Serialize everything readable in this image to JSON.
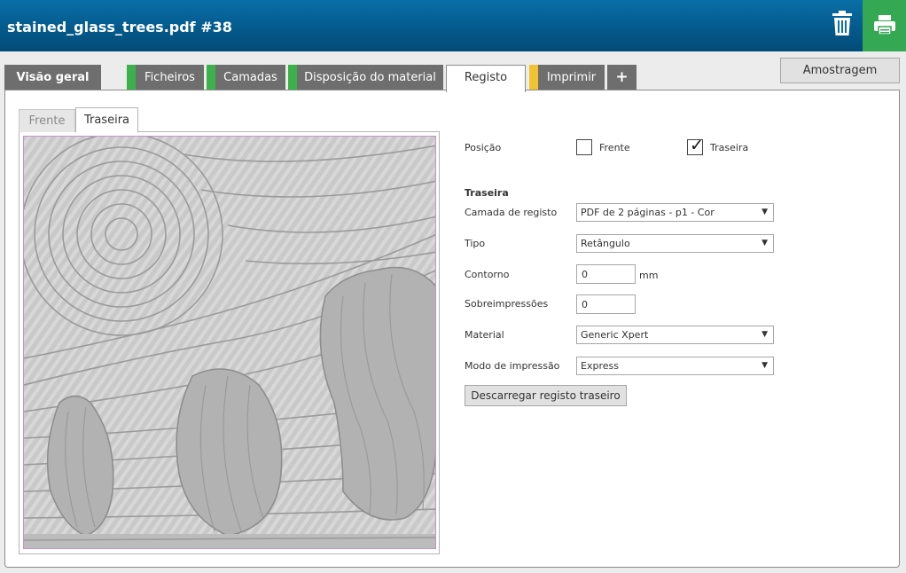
{
  "header": {
    "title": "stained_glass_trees.pdf #38",
    "icons": {
      "delete": "trash-icon",
      "print": "printer-icon"
    }
  },
  "tabs": [
    {
      "label": "Visão geral",
      "flag_color": ""
    },
    {
      "label": "Ficheiros",
      "flag_color": "#3cb04a"
    },
    {
      "label": "Camadas",
      "flag_color": "#3cb04a"
    },
    {
      "label": "Disposição do material",
      "flag_color": "#3cb04a"
    },
    {
      "label": "Registo",
      "flag_color": ""
    },
    {
      "label": "Imprimir",
      "flag_color": "#f2c230"
    },
    {
      "label": "+",
      "flag_color": ""
    }
  ],
  "active_tab": "Registo",
  "sample_button": "Amostragem",
  "side_tabs": {
    "front": "Frente",
    "back": "Traseira",
    "active": "Traseira"
  },
  "form": {
    "position_label": "Posição",
    "position_front": {
      "label": "Frente",
      "checked": false
    },
    "position_back": {
      "label": "Traseira",
      "checked": true
    },
    "section_title": "Traseira",
    "layer_label": "Camada de registo",
    "layer_value": "PDF de 2 páginas - p1 - Cor",
    "type_label": "Tipo",
    "type_value": "Retângulo",
    "contour_label": "Contorno",
    "contour_value": "0",
    "contour_unit": "mm",
    "overprint_label": "Sobreimpressões",
    "overprint_value": "0",
    "material_label": "Material",
    "material_value": "Generic Xpert",
    "mode_label": "Modo de impressão",
    "mode_value": "Express",
    "download_button": "Descarregar registo traseiro"
  },
  "colors": {
    "header": "#045a8c",
    "print_button": "#34a853",
    "tab_inactive": "#6e6e6e",
    "flag_green": "#3cb04a",
    "flag_yellow": "#f2c230"
  }
}
